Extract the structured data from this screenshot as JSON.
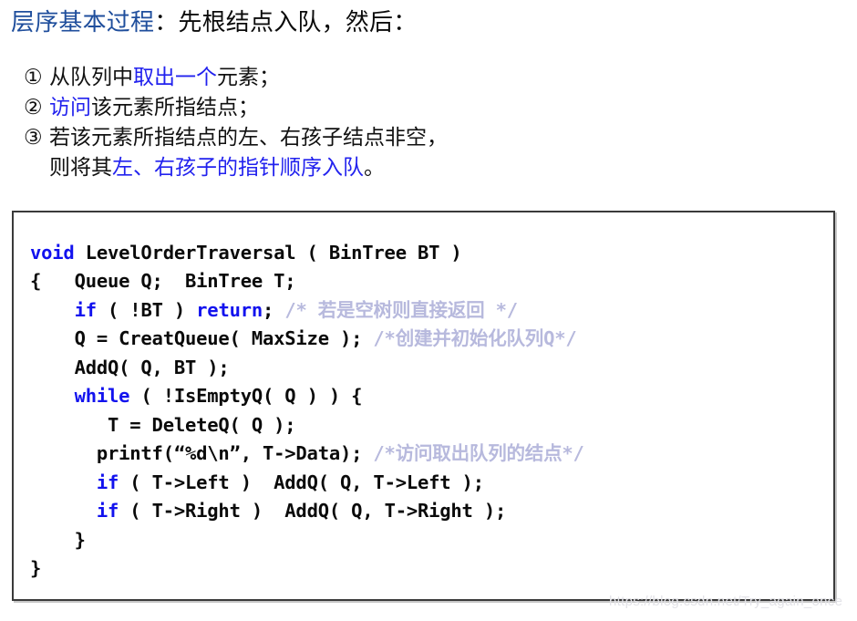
{
  "colors": {
    "title_blue": "#1F4E9C",
    "highlight_blue": "#2222EE",
    "keyword_blue": "#1212EE",
    "comment_gray": "#b7b9dd",
    "body_black": "#111111",
    "box_border": "#3a3a3a"
  },
  "title": {
    "blue_part": "层序基本过程",
    "black_part": "：先根结点入队，然后："
  },
  "steps": [
    {
      "marker": "①",
      "lines": [
        [
          {
            "text": "从队列中",
            "color": "black"
          },
          {
            "text": "取出一个",
            "color": "blue"
          },
          {
            "text": "元素；",
            "color": "black"
          }
        ]
      ]
    },
    {
      "marker": "②",
      "lines": [
        [
          {
            "text": "访问",
            "color": "blue"
          },
          {
            "text": "该元素所指结点；",
            "color": "black"
          }
        ]
      ]
    },
    {
      "marker": "③",
      "lines": [
        [
          {
            "text": "若该元素所指结点的左、右孩子结点非空，",
            "color": "black"
          }
        ],
        [
          {
            "text": "则将其",
            "color": "black"
          },
          {
            "text": "左、右孩子的指针顺序入队",
            "color": "blue"
          },
          {
            "text": "。",
            "color": "black"
          }
        ]
      ]
    }
  ],
  "code": {
    "language": "c",
    "lines": [
      [
        {
          "text": "void",
          "type": "keyword"
        },
        {
          "text": " LevelOrderTraversal ( BinTree BT )",
          "type": "plain"
        }
      ],
      [
        {
          "text": "{   Queue Q;  BinTree T;",
          "type": "plain"
        }
      ],
      [
        {
          "text": "    ",
          "type": "plain"
        },
        {
          "text": "if",
          "type": "keyword"
        },
        {
          "text": " ( !BT ) ",
          "type": "plain"
        },
        {
          "text": "return",
          "type": "keyword"
        },
        {
          "text": "; ",
          "type": "plain"
        },
        {
          "text": "/* 若是空树则直接返回 */",
          "type": "comment"
        }
      ],
      [
        {
          "text": "    Q = CreatQueue( MaxSize ); ",
          "type": "plain"
        },
        {
          "text": "/*创建并初始化队列Q*/",
          "type": "comment"
        }
      ],
      [
        {
          "text": "    AddQ( Q, BT );",
          "type": "plain"
        }
      ],
      [
        {
          "text": "    ",
          "type": "plain"
        },
        {
          "text": "while",
          "type": "keyword"
        },
        {
          "text": " ( !IsEmptyQ( Q ) ) {",
          "type": "plain"
        }
      ],
      [
        {
          "text": "       T = DeleteQ( Q );",
          "type": "plain"
        }
      ],
      [
        {
          "text": "      printf(“%d\\n”, T->Data); ",
          "type": "plain"
        },
        {
          "text": "/*访问取出队列的结点*/",
          "type": "comment"
        }
      ],
      [
        {
          "text": "      ",
          "type": "plain"
        },
        {
          "text": "if",
          "type": "keyword"
        },
        {
          "text": " ( T->Left )  AddQ( Q, T->Left );",
          "type": "plain"
        }
      ],
      [
        {
          "text": "      ",
          "type": "plain"
        },
        {
          "text": "if",
          "type": "keyword"
        },
        {
          "text": " ( T->Right )  AddQ( Q, T->Right );",
          "type": "plain"
        }
      ],
      [
        {
          "text": "    }",
          "type": "plain"
        }
      ],
      [
        {
          "text": "}",
          "type": "plain"
        }
      ]
    ]
  },
  "watermark": {
    "text": "https://blog.csdn.net/Try_again_once"
  }
}
